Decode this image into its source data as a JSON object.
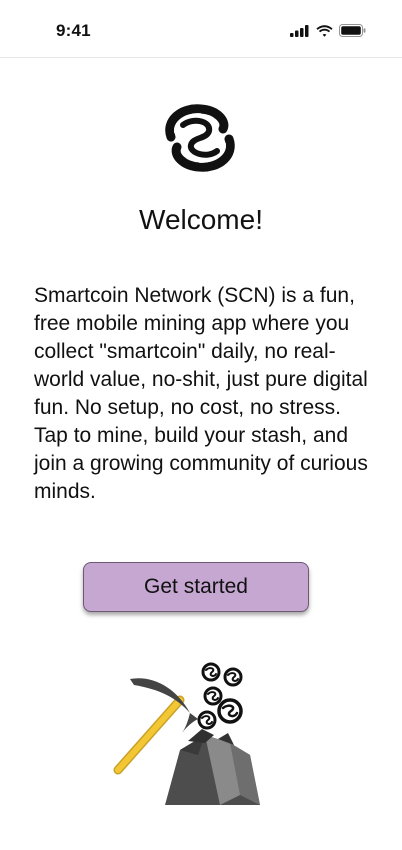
{
  "status_bar": {
    "time": "9:41",
    "icons": [
      "signal-icon",
      "wifi-icon",
      "battery-icon"
    ]
  },
  "welcome": {
    "title": "Welcome!",
    "description": "Smartcoin Network (SCN) is a fun, free mobile mining app where you collect \"smartcoin\" daily, no real-world value, no-shit, just pure digital fun. No setup, no cost, no stress. Tap to mine, build your stash, and join a growing community of curious minds.",
    "cta_label": "Get started"
  },
  "colors": {
    "cta_background": "#c5a7d1",
    "cta_border": "#6d5a72",
    "pickaxe_handle": "#f0c030",
    "rock": "#555555"
  },
  "icons": {
    "logo": "smartcoin-logo-icon",
    "illustration": "pickaxe-mining-illustration"
  }
}
